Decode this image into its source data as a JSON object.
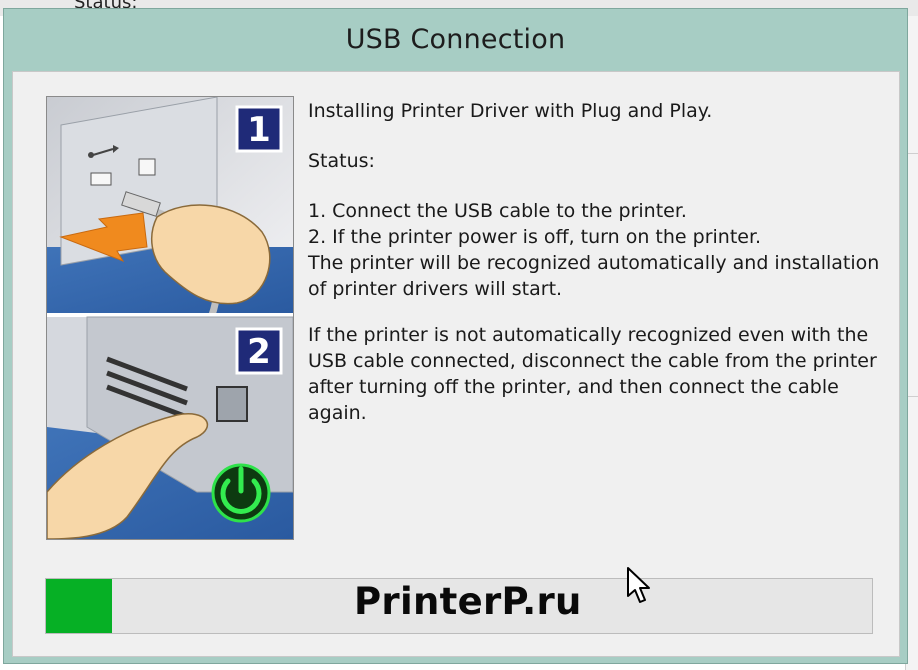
{
  "background": {
    "partial_text": "Status:"
  },
  "dialog": {
    "title": "USB Connection",
    "intro": "Installing Printer Driver with Plug and Play.",
    "status_label": "Status:",
    "instructions": [
      "1. Connect the USB cable to the printer.",
      "2. If the printer power is off, turn on the printer.",
      "The printer will be recognized automatically and installation",
      "of printer drivers will start."
    ],
    "note": [
      "If the printer is not automatically recognized even with the",
      "USB cable connected, disconnect the cable from the printer",
      "after turning off the printer, and then connect the cable",
      "again."
    ],
    "steps": [
      "1",
      "2"
    ]
  },
  "progress": {
    "fraction": 0.08
  },
  "watermark": "PrinterP.ru",
  "icons": [
    "usb-symbol-icon",
    "power-icon",
    "mouse-cursor-icon"
  ],
  "colors": {
    "frame": "#a7cdc4",
    "content_bg": "#f0f0f0",
    "progress_fill": "#06b025",
    "step_badge": "#1f2a78",
    "power_green": "#0fbf2a"
  }
}
